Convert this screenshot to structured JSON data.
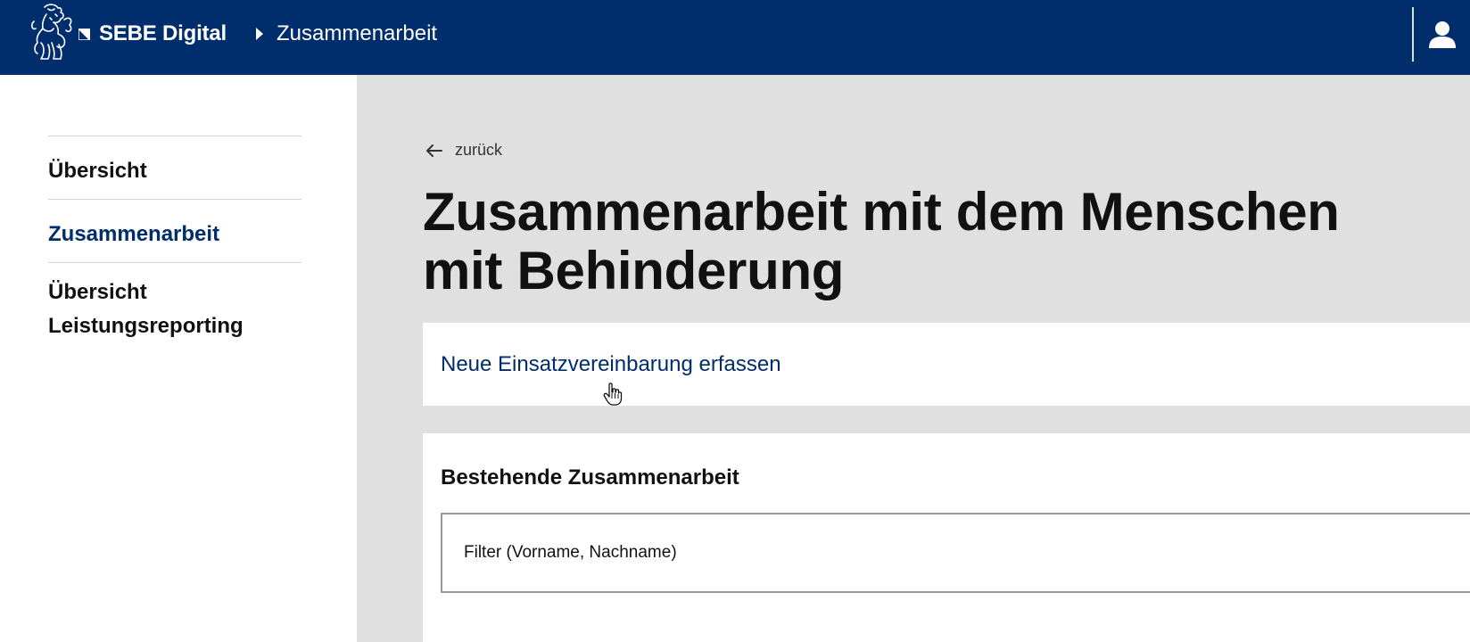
{
  "header": {
    "brand": "SEBE Digital",
    "breadcrumb_current": "Zusammenarbeit",
    "logo_icon": "lion-icon",
    "user_icon": "user-icon",
    "colors": {
      "header_bg": "#002d6b",
      "link": "#002d6b"
    }
  },
  "sidebar": {
    "items": [
      {
        "label": "Übersicht",
        "active": false
      },
      {
        "label": "Zusammenarbeit",
        "active": true
      },
      {
        "label_line1": "Übersicht",
        "label_line2": "Leistungsreporting",
        "active": false
      }
    ]
  },
  "main": {
    "back_label": "zurück",
    "title_line1": "Zusammenarbeit mit dem Menschen",
    "title_line2": "mit Behinderung",
    "new_link": "Neue Einsatzvereinbarung erfassen",
    "existing_title": "Bestehende Zusammenarbeit",
    "filter_placeholder": "Filter (Vorname, Nachname)",
    "filter_value": ""
  }
}
